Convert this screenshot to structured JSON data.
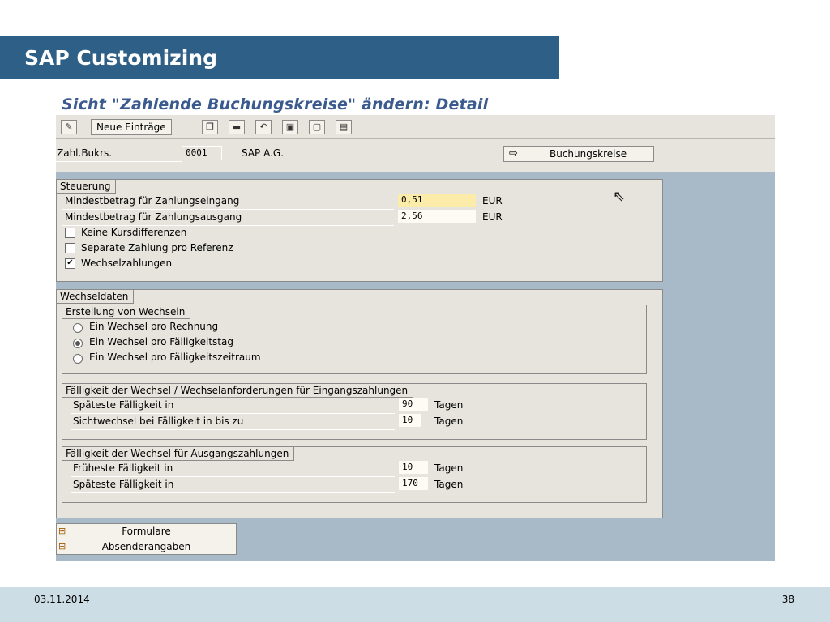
{
  "slide": {
    "title": "SAP Customizing",
    "date": "03.11.2014",
    "page": "38"
  },
  "sap": {
    "screen_title": "Sicht \"Zahlende Buchungskreise\" ändern: Detail",
    "toolbar": {
      "new_entries": "Neue Einträge",
      "icons": [
        "edit-glasses-icon",
        "copy-icon",
        "delete-icon",
        "undo-icon",
        "select-all-icon",
        "deselect-icon",
        "print-icon"
      ]
    },
    "header": {
      "company_label": "Zahl.Bukrs.",
      "company_value": "0001",
      "company_name": "SAP A.G.",
      "company_codes_button": "Buchungskreise"
    },
    "steuerung": {
      "title": "Steuerung",
      "min_in_label": "Mindestbetrag für Zahlungseingang",
      "min_in_value": "0,51",
      "min_in_currency": "EUR",
      "min_out_label": "Mindestbetrag für Zahlungsausgang",
      "min_out_value": "2,56",
      "min_out_currency": "EUR",
      "cb1": "Keine Kursdifferenzen",
      "cb2": "Separate Zahlung pro Referenz",
      "cb3": "Wechselzahlungen"
    },
    "wechseldaten": {
      "title": "Wechseldaten",
      "erstellung": {
        "title": "Erstellung von Wechseln",
        "r1": "Ein Wechsel pro Rechnung",
        "r2": "Ein Wechsel pro Fälligkeitstag",
        "r3": "Ein Wechsel pro Fälligkeitszeitraum"
      },
      "eingang": {
        "title": "Fälligkeit der Wechsel / Wechselanforderungen für Eingangszahlungen",
        "row1_label": "Späteste Fälligkeit in",
        "row1_value": "90",
        "row1_unit": "Tagen",
        "row2_label": "Sichtwechsel bei Fälligkeit in bis zu",
        "row2_value": "10",
        "row2_unit": "Tagen"
      },
      "ausgang": {
        "title": "Fälligkeit der Wechsel für Ausgangszahlungen",
        "row1_label": "Früheste Fälligkeit in",
        "row1_value": "10",
        "row1_unit": "Tagen",
        "row2_label": "Späteste Fälligkeit in",
        "row2_value": "170",
        "row2_unit": "Tagen"
      }
    },
    "bottom_buttons": {
      "forms": "Formulare",
      "sender": "Absenderangaben"
    }
  }
}
